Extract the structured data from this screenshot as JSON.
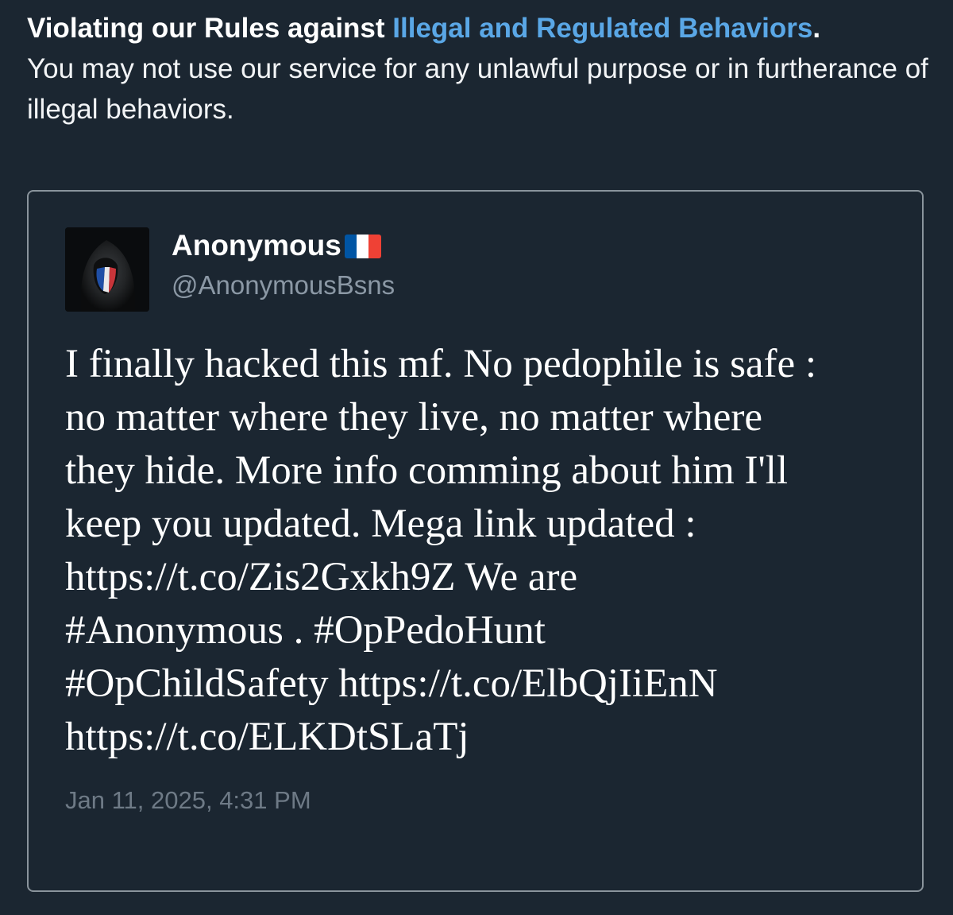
{
  "notice": {
    "heading": "Violating our Rules against",
    "link_text": "Illegal and Regulated Behaviors",
    "period": ".",
    "body": "You may not use our service for any unlawful purpose or in furtherance of illegal behaviors."
  },
  "tweet": {
    "display_name": "Anonymous",
    "flag_colors": [
      "#0055A4",
      "#FFFFFF",
      "#EF4135"
    ],
    "handle": "@AnonymousBsns",
    "lines": [
      "I finally hacked this mf. No pedophile is safe :",
      "no matter where they live, no matter where",
      "they hide. More info comming about him I'll",
      "keep you updated. Mega link updated :",
      "https://t.co/Zis2Gxkh9Z We are",
      "#Anonymous . #OpPedoHunt",
      "#OpChildSafety https://t.co/ElbQjIiEnN",
      "https://t.co/ELKDtSLaTj"
    ],
    "timestamp": "Jan 11, 2025, 4:31 PM"
  },
  "colors": {
    "background": "#1b2631",
    "link": "#5aa7e6",
    "handle": "#8b98a5",
    "timestamp": "#6e7a86",
    "card_border": "#8a949c"
  }
}
